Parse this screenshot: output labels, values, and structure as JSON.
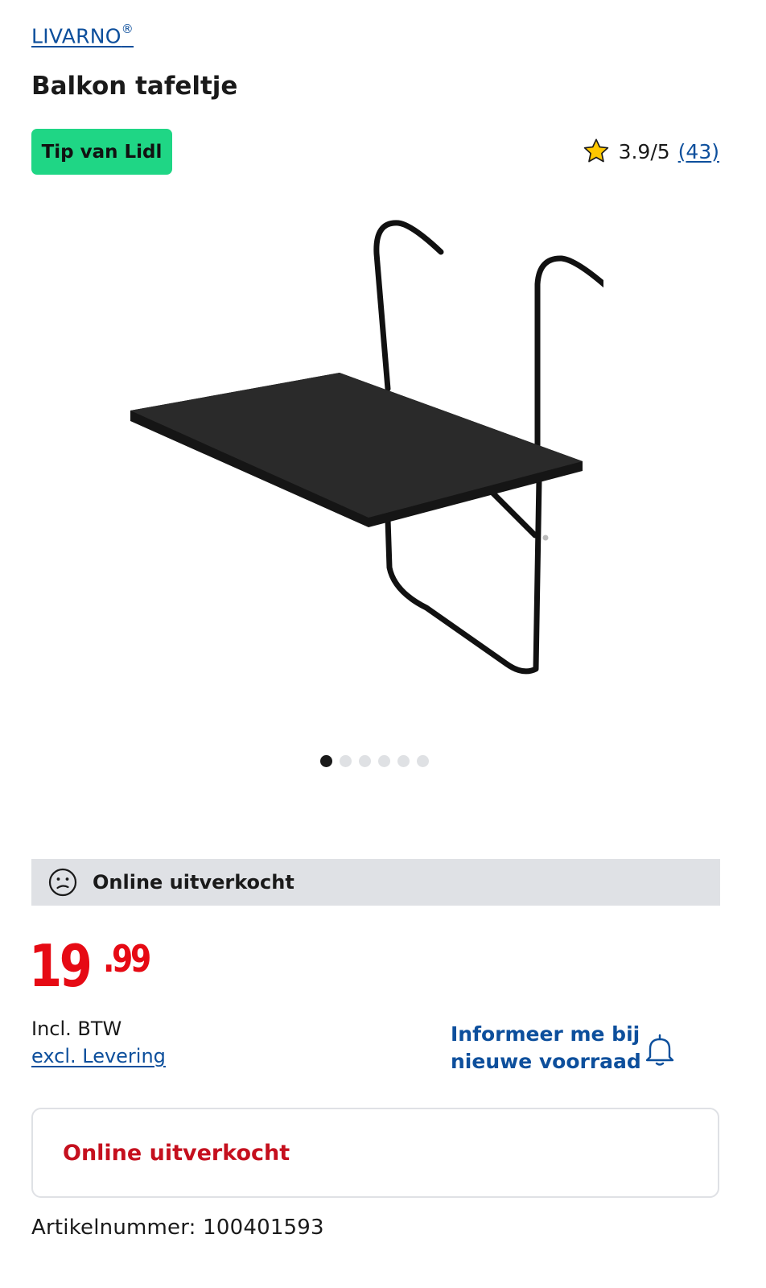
{
  "brand": {
    "name": "LIVARNO",
    "mark": "®"
  },
  "product": {
    "title": "Balkon tafeltje"
  },
  "badge": {
    "label": "Tip van Lidl",
    "color": "#1fd685"
  },
  "rating": {
    "score": "3.9/5",
    "count_open": "(",
    "count": "43",
    "count_close": ")",
    "icon": "star-icon"
  },
  "gallery": {
    "slides": 6,
    "active_index": 0
  },
  "availability": {
    "banner": "Online uitverkocht",
    "icon": "sad-face-icon"
  },
  "price": {
    "integer": "19",
    "decimal": ".99",
    "color": "#e60a14"
  },
  "price_notes": {
    "vat": "Incl. BTW",
    "delivery": "excl. Levering"
  },
  "notify": {
    "line1": "Informeer me bij",
    "line2": "nieuwe voorraad",
    "icon": "bell-icon"
  },
  "status_card": {
    "label": "Online uitverkocht"
  },
  "sku": {
    "label": "Artikelnummer: 100401593"
  },
  "colors": {
    "link": "#0d4f9c",
    "soldout_text": "#c5101e",
    "banner_bg": "#dfe1e5"
  }
}
